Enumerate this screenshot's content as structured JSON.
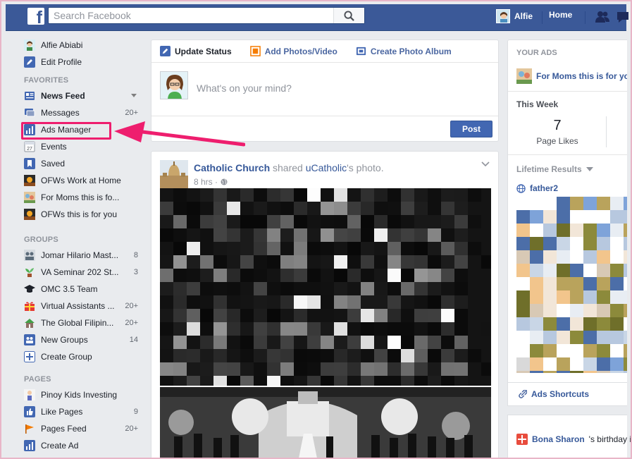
{
  "topbar": {
    "logo_letter": "f",
    "search_placeholder": "Search Facebook",
    "user_name": "Alfie",
    "home_label": "Home"
  },
  "leftnav": {
    "profile": [
      {
        "label": "Alfie Abiabi",
        "icon": "user-avatar-icon"
      },
      {
        "label": "Edit Profile",
        "icon": "pencil-icon"
      }
    ],
    "favorites_heading": "FAVORITES",
    "favorites": [
      {
        "label": "News Feed",
        "icon": "news-feed-icon",
        "count": "",
        "bold": true
      },
      {
        "label": "Messages",
        "icon": "messages-icon",
        "count": "20+"
      },
      {
        "label": "Ads Manager",
        "icon": "ads-manager-icon",
        "count": ""
      },
      {
        "label": "Events",
        "icon": "calendar-icon",
        "count": ""
      },
      {
        "label": "Saved",
        "icon": "bookmark-icon",
        "count": ""
      },
      {
        "label": "OFWs Work at Home",
        "icon": "page-thumb-icon",
        "count": ""
      },
      {
        "label": "For Moms this is fo...",
        "icon": "page-thumb-icon",
        "count": ""
      },
      {
        "label": "OFWs this is for you",
        "icon": "page-thumb-icon",
        "count": ""
      }
    ],
    "groups_heading": "GROUPS",
    "groups": [
      {
        "label": "Jomar Hilario Mast...",
        "icon": "group-icon",
        "count": "8"
      },
      {
        "label": "VA Seminar 202 St...",
        "icon": "plant-icon",
        "count": "3"
      },
      {
        "label": "OMC 3.5 Team",
        "icon": "grad-cap-icon",
        "count": ""
      },
      {
        "label": "Virtual Assistants ...",
        "icon": "gift-icon",
        "count": "20+"
      },
      {
        "label": "The Global Filipin...",
        "icon": "house-icon",
        "count": "20+"
      },
      {
        "label": "New Groups",
        "icon": "new-groups-icon",
        "count": "14"
      },
      {
        "label": "Create Group",
        "icon": "plus-icon",
        "count": ""
      }
    ],
    "pages_heading": "PAGES",
    "pages": [
      {
        "label": "Pinoy Kids Investing",
        "icon": "page-thumb-icon",
        "count": ""
      },
      {
        "label": "Like Pages",
        "icon": "like-icon",
        "count": "9"
      },
      {
        "label": "Pages Feed",
        "icon": "flag-icon",
        "count": "20+"
      },
      {
        "label": "Create Ad",
        "icon": "ads-manager-icon",
        "count": ""
      }
    ]
  },
  "composer": {
    "tabs": [
      "Update Status",
      "Add Photos/Video",
      "Create Photo Album"
    ],
    "placeholder": "What's on your mind?",
    "post_label": "Post"
  },
  "story": {
    "source": "Catholic Church",
    "middle": " shared ",
    "target": "uCatholic",
    "suffix": "'s photo.",
    "time": "8 hrs ·"
  },
  "right": {
    "your_ads": "YOUR ADS",
    "ad_name": "For Moms this is for yo",
    "this_week": "This Week",
    "page_likes_value": "7",
    "page_likes_label": "Page Likes",
    "lifetime": "Lifetime Results",
    "campaign": "father2",
    "shortcuts": "Ads Shortcuts",
    "birthday_name": "Bona Sharon",
    "birthday_rest": "'s birthday is"
  },
  "colors": {
    "brand": "#3b5998",
    "link": "#365899",
    "highlight": "#ee1e6e"
  }
}
